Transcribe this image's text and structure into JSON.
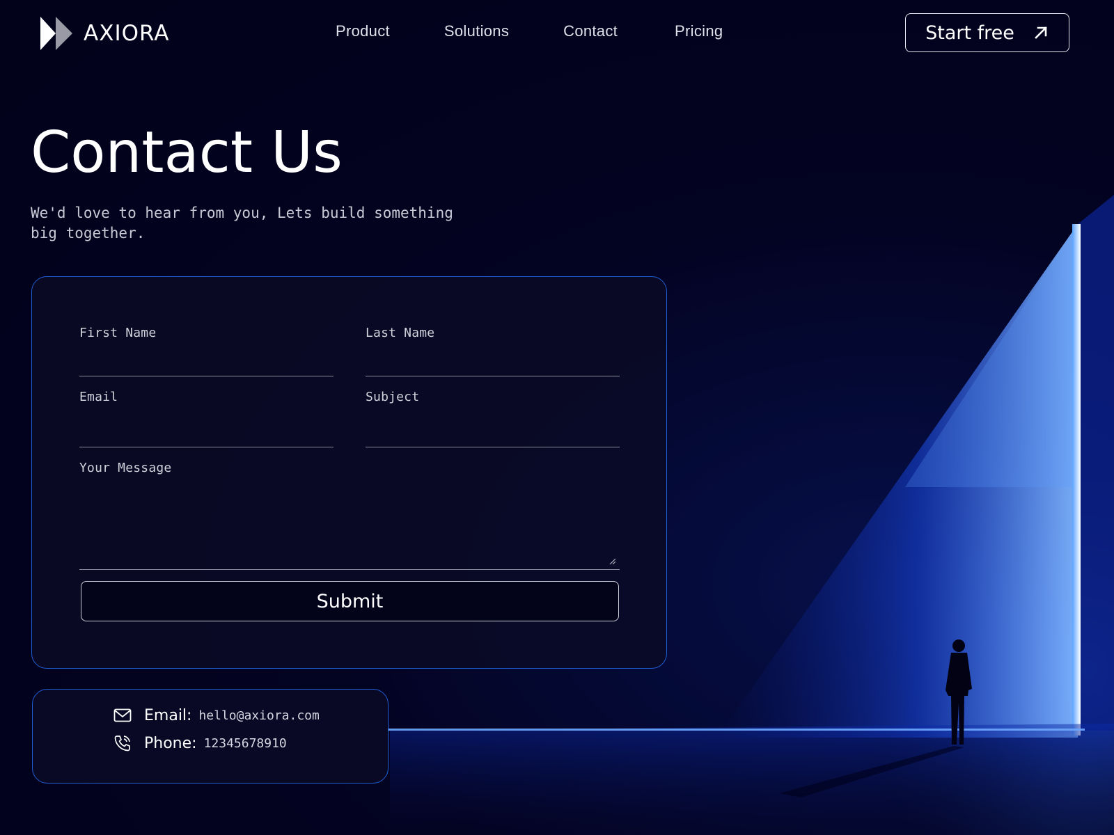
{
  "brand": {
    "name": "AXIORA"
  },
  "nav": {
    "links": [
      "Product",
      "Solutions",
      "Contact",
      "Pricing"
    ],
    "cta_label": "Start free"
  },
  "hero": {
    "title": "Contact Us",
    "subtitle": "We'd love to hear from you, Lets build something big together."
  },
  "form": {
    "first_name_label": "First Name",
    "last_name_label": "Last Name",
    "email_label": "Email",
    "subject_label": "Subject",
    "message_label": "Your Message",
    "submit_label": "Submit"
  },
  "info": {
    "email_key": "Email:",
    "email_value": "hello@axiora.com",
    "phone_key": "Phone:",
    "phone_value": "12345678910"
  },
  "icons": {
    "logo": "double-chevron-logo-icon",
    "cta": "arrow-up-right-icon",
    "email": "envelope-icon",
    "phone": "phone-ringing-icon"
  },
  "colors": {
    "background": "#02021a",
    "accent_border": "#1f5fd6",
    "light_beam": "#2f7bff"
  }
}
